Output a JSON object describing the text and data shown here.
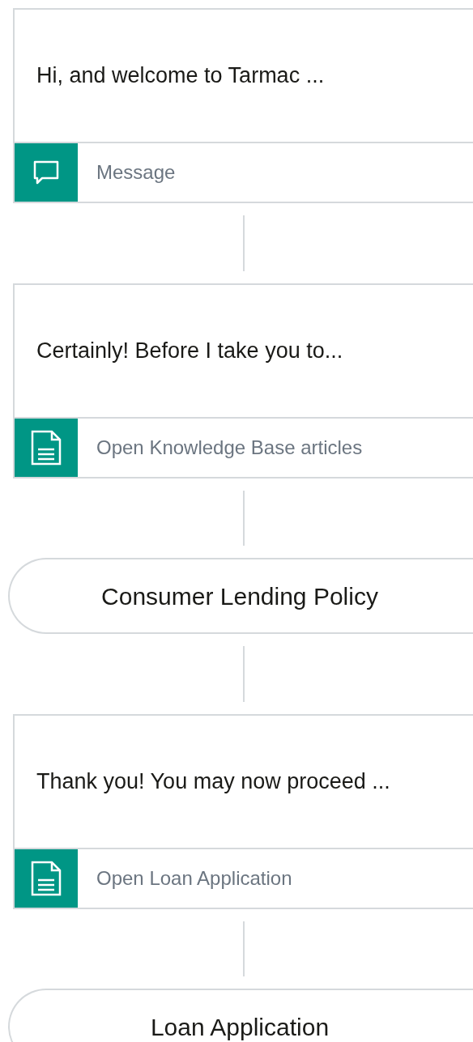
{
  "flow": [
    {
      "kind": "step",
      "text": "Hi, and welcome to Tarmac ...",
      "action": {
        "kind": "chat",
        "label": "Message"
      }
    },
    {
      "kind": "step",
      "text": "Certainly! Before I take you to...",
      "action": {
        "kind": "document",
        "label": "Open Knowledge Base articles"
      }
    },
    {
      "kind": "link",
      "label": "Consumer Lending Policy"
    },
    {
      "kind": "step",
      "text": "Thank you! You may now proceed ...",
      "action": {
        "kind": "document",
        "label": "Open Loan Application"
      }
    },
    {
      "kind": "link",
      "label": "Loan Application"
    }
  ]
}
